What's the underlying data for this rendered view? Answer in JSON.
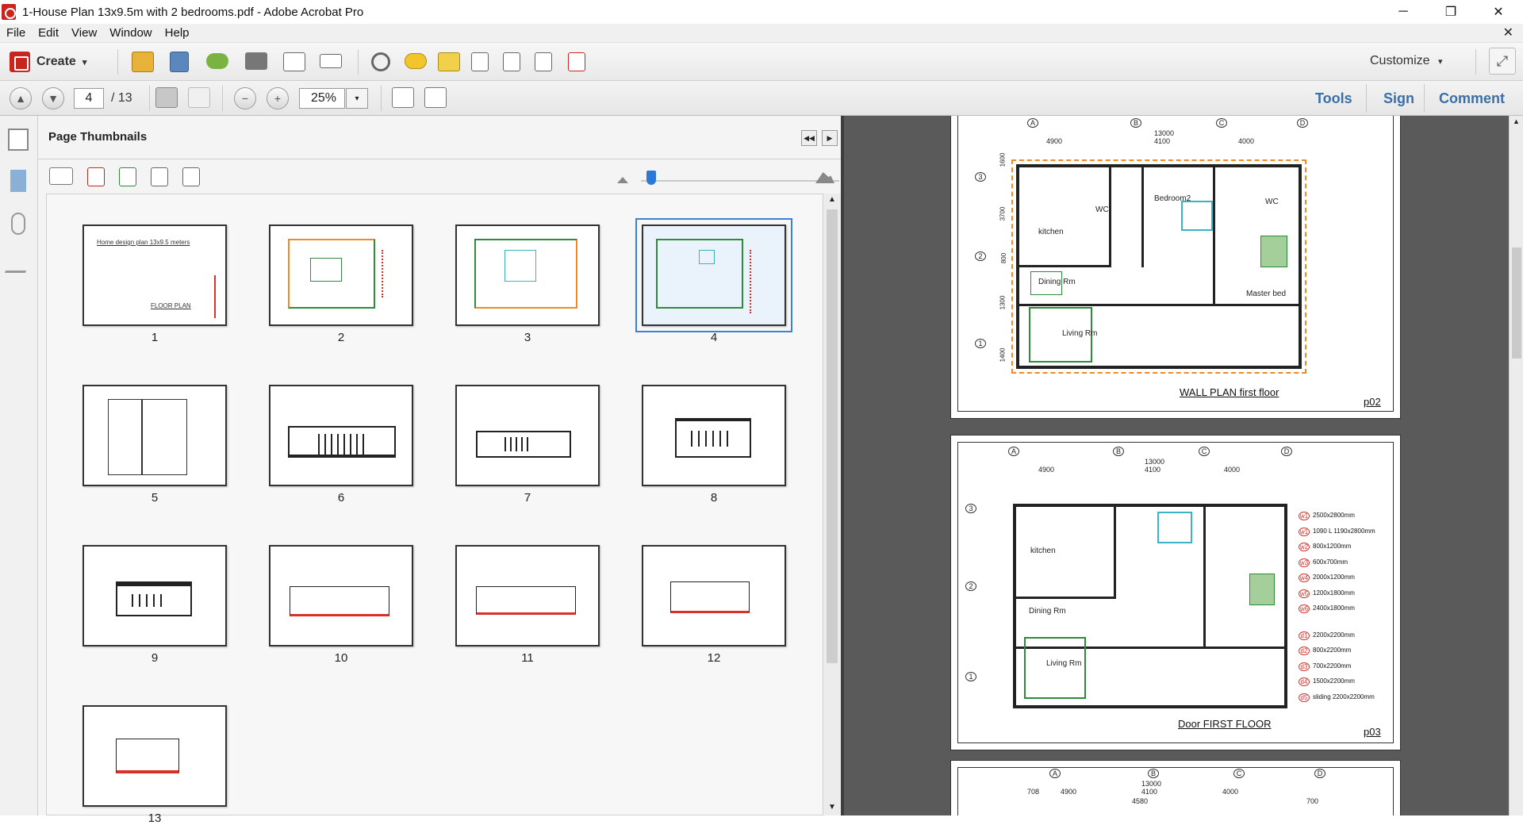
{
  "window": {
    "title": "1-House Plan 13x9.5m with 2 bedrooms.pdf - Adobe Acrobat Pro",
    "minimize": "─",
    "restore": "❐",
    "close": "✕"
  },
  "menu": {
    "items": [
      "File",
      "Edit",
      "View",
      "Window",
      "Help"
    ],
    "close_doc": "✕"
  },
  "toolbar": {
    "create_label": "Create",
    "create_arrow": "▾",
    "customize_label": "Customize",
    "customize_arrow": "▾",
    "expand_glyph": "⤢"
  },
  "navbar": {
    "prev_glyph": "▲",
    "next_glyph": "▼",
    "current_page": "4",
    "page_total": "/ 13",
    "zoom": "25%",
    "zoom_arrow": "▾",
    "tools_label": "Tools",
    "sign_label": "Sign",
    "comment_label": "Comment"
  },
  "panel": {
    "title": "Page Thumbnails",
    "collapse_glyph": "◀◀",
    "next_glyph": "▶",
    "size_slider_fraction": 0.05
  },
  "thumbnails": [
    {
      "label": "1",
      "heading": "Home design plan 13x9.5 meters",
      "sub": "FLOOR PLAN"
    },
    {
      "label": "2"
    },
    {
      "label": "3"
    },
    {
      "label": "4",
      "selected": true
    },
    {
      "label": "5"
    },
    {
      "label": "6"
    },
    {
      "label": "7"
    },
    {
      "label": "8"
    },
    {
      "label": "9"
    },
    {
      "label": "10"
    },
    {
      "label": "11"
    },
    {
      "label": "12"
    },
    {
      "label": "13"
    }
  ],
  "document": {
    "page_a": {
      "caption": "WALL PLAN first floor",
      "number": "p02",
      "rooms": [
        "Bedroom2",
        "kitchen",
        "WC",
        "WC",
        "Dining Rm",
        "Master bed",
        "Living Rm"
      ],
      "dims_top": [
        "13000",
        "4900",
        "4100",
        "4000"
      ],
      "dims_left": [
        "1600",
        "3700",
        "800",
        "1300",
        "1400"
      ],
      "grid_top": [
        "A",
        "B",
        "C",
        "D"
      ],
      "grid_left": [
        "3",
        "2",
        "1"
      ]
    },
    "page_b": {
      "caption": "Door FIRST FLOOR",
      "number": "p03",
      "rooms": [
        "kitchen",
        "Dining Rm",
        "Living Rm"
      ],
      "dims_top": [
        "13000",
        "4900",
        "4100",
        "4000"
      ],
      "grid_top": [
        "A",
        "B",
        "C",
        "D"
      ],
      "grid_left": [
        "3",
        "2",
        "1"
      ],
      "legend": [
        "2500x2800mm",
        "1090 L 1190x2800mm",
        "800x1200mm",
        "600x700mm",
        "2000x1200mm",
        "1200x1800mm",
        "2400x1800mm",
        "2200x2200mm",
        "800x2200mm",
        "700x2200mm",
        "1500x2200mm",
        "sliding 2200x2200mm"
      ],
      "legend_codes": [
        "w1",
        "w1",
        "w2",
        "w3",
        "w4",
        "w5",
        "w6",
        "d1",
        "d2",
        "d3",
        "d4",
        "d5"
      ]
    },
    "page_c": {
      "dims_top": [
        "13000",
        "4900",
        "4100",
        "4000"
      ],
      "dims_sub": [
        "708",
        "4580",
        "700"
      ],
      "grid_top": [
        "A",
        "B",
        "C",
        "D"
      ]
    }
  },
  "colors": {
    "accent_blue": "#3a6fa8",
    "plan_green": "#2e8b3a",
    "plan_orange": "#f08a24",
    "plan_red": "#d9302a",
    "plan_cyan": "#3bb3c3"
  }
}
